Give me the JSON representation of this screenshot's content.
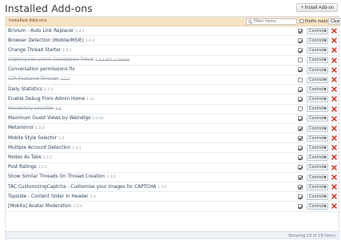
{
  "page": {
    "title": "Installed Add-ons",
    "install_button": "+ Install Add-on"
  },
  "header": {
    "caption": "Installed Add-ons",
    "filter_placeholder": "Filter items",
    "prefix_match": "Prefix match",
    "clear": "Clear"
  },
  "row_controls": {
    "controls_label": "Controls"
  },
  "addons": [
    {
      "name": "Brivium - Auto Link Replacer",
      "version": "1.4.1",
      "enabled": true
    },
    {
      "name": "Browser Detection (Mobile/MSIE)",
      "version": "1.0.0",
      "enabled": true
    },
    {
      "name": "Change Thread Starter",
      "version": "1.0.1",
      "enabled": true
    },
    {
      "name": "Clipthepaws.com's Countdown Timer",
      "version": "1.0.4 XF1.x Update",
      "enabled": false
    },
    {
      "name": "Conversation permissions fix",
      "version": "",
      "enabled": true
    },
    {
      "name": "CTA Featured Threads",
      "version": "1.2.3",
      "enabled": false
    },
    {
      "name": "Daily Statistics",
      "version": "1.1.2",
      "enabled": true
    },
    {
      "name": "Enable Debug From Admin Home",
      "version": "1.1a",
      "enabled": true
    },
    {
      "name": "Mandatory Location",
      "version": "1.0",
      "enabled": false
    },
    {
      "name": "Maximum Guest Views by Waindigo",
      "version": "1.0.1b",
      "enabled": true
    },
    {
      "name": "Metamirror",
      "version": "1.0.0",
      "enabled": true
    },
    {
      "name": "Mobile Style Selector",
      "version": "1.3",
      "enabled": true
    },
    {
      "name": "Multiple Account Detection",
      "version": "1.0.1",
      "enabled": true
    },
    {
      "name": "Nodes As Tabs",
      "version": "1.2.2",
      "enabled": true
    },
    {
      "name": "Post Ratings",
      "version": "1.5.1",
      "enabled": true
    },
    {
      "name": "Show Similar Threads On Thread Creation",
      "version": "1.1.0",
      "enabled": true
    },
    {
      "name": "TAC CustomizingCaptcha - Customise your Images for CAPTCHA",
      "version": "1.1.9",
      "enabled": true
    },
    {
      "name": "Topslide - Content Slider In Header",
      "version": "2.0",
      "enabled": true
    },
    {
      "name": "[Mobita] Avatar Moderation",
      "version": "1.0.0",
      "enabled": true
    }
  ],
  "footer": {
    "count_text": "Showing 19 of 19 items"
  },
  "colors": {
    "header_bg": "#f6e3c6",
    "link": "#2b3f59",
    "delete": "#d23b2b"
  },
  "icons": {
    "filter": "magnifier-icon",
    "delete": "delete-x-icon",
    "dropdown": "chevron-down-icon"
  }
}
